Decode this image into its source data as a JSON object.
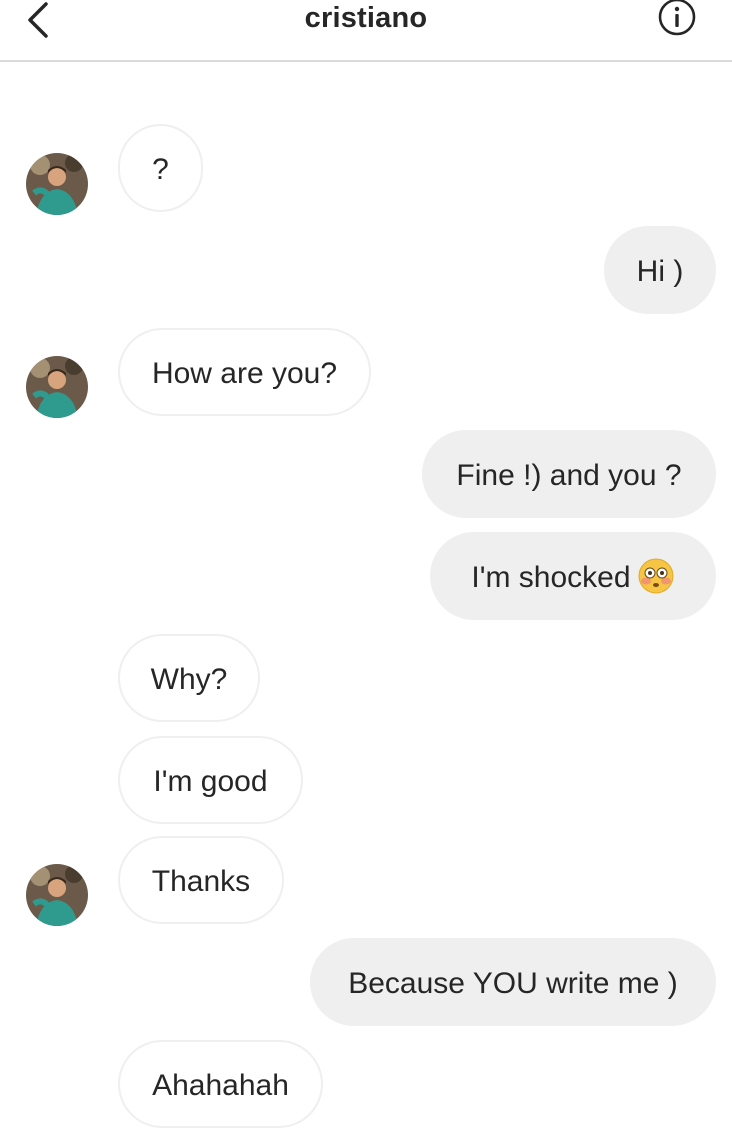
{
  "header": {
    "title": "cristiano",
    "back_icon": "chevron-left-icon",
    "info_icon": "info-icon"
  },
  "contact": {
    "avatar_icon": "avatar"
  },
  "messages": [
    {
      "from": "them",
      "text": "?"
    },
    {
      "from": "me",
      "text": "Hi )"
    },
    {
      "from": "them",
      "text": "How are you?"
    },
    {
      "from": "me",
      "text": "Fine !) and you ?"
    },
    {
      "from": "me",
      "text": "I'm shocked",
      "emoji": "flushed-face-emoji"
    },
    {
      "from": "them",
      "text": "Why?"
    },
    {
      "from": "them",
      "text": "I'm good"
    },
    {
      "from": "them",
      "text": "Thanks"
    },
    {
      "from": "me",
      "text": "Because YOU write me )"
    },
    {
      "from": "them",
      "text": "Ahahahah"
    }
  ],
  "colors": {
    "outgoing_bubble": "#efefef",
    "incoming_border": "#efefef",
    "text": "#262626",
    "divider": "#dbdbdb"
  }
}
